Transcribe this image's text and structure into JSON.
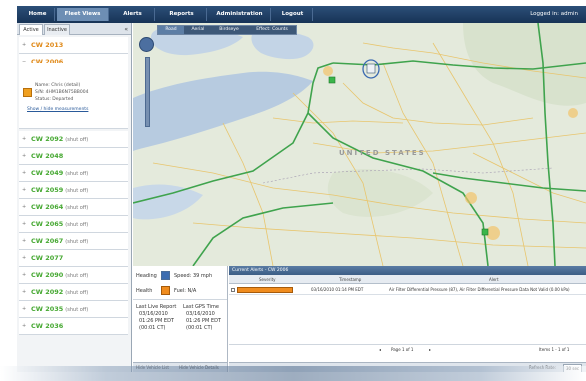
{
  "nav": {
    "tabs": [
      "Home",
      "Fleet Views",
      "Alerts",
      "Reports",
      "Administration",
      "Logout"
    ],
    "logged_in": "Logged in: admin"
  },
  "left": {
    "subtabs": [
      "Active",
      "Inactive"
    ],
    "vehicles": [
      {
        "name": "CW 2013",
        "status": ""
      },
      {
        "name": "CW 2006",
        "status": ""
      },
      {
        "name": "CW 2092",
        "status": "(shut off)"
      },
      {
        "name": "CW 2048",
        "status": ""
      },
      {
        "name": "CW 2049",
        "status": "(shut off)"
      },
      {
        "name": "CW 2059",
        "status": "(shut off)"
      },
      {
        "name": "CW 2064",
        "status": "(shut off)"
      },
      {
        "name": "CW 2065",
        "status": "(shut off)"
      },
      {
        "name": "CW 2067",
        "status": "(shut off)"
      },
      {
        "name": "CW 2077",
        "status": ""
      },
      {
        "name": "CW 2090",
        "status": "(shut off)"
      },
      {
        "name": "CW 2092",
        "status": "(shut off)"
      },
      {
        "name": "CW 2035",
        "status": "(shut off)"
      },
      {
        "name": "CW 2036",
        "status": ""
      }
    ],
    "detail": {
      "line1": "Name: Chris (detail)",
      "line2": "S/N: 4HM1B6N75BB004",
      "line3": "Status: Departed",
      "link": "Show / hide measurements"
    }
  },
  "map": {
    "toolbar": [
      "Road",
      "Aerial",
      "Birdseye",
      "Effect: Counts"
    ],
    "country_label": "UNITED STATES",
    "colors": {
      "water": "#b7cbe0",
      "land": "#e4eadc",
      "highway": "#3fa34d",
      "road": "#f1c766"
    }
  },
  "info": {
    "heading_label": "Heading",
    "speed": "Speed: 39 mph",
    "health_label": "Health",
    "fuel": "Fuel: N/A",
    "last_live_report_title": "Last Live Report",
    "last_live_report": [
      "03/16/2010",
      "01:26 PM EDT",
      "(00:01 CT)"
    ],
    "last_gps_title": "Last GPS Time",
    "last_gps": [
      "03/16/2010",
      "01:26 PM EDT",
      "(00:01 CT)"
    ],
    "toggles": [
      "Hide Vehicle List",
      "Hide Vehicle Details"
    ]
  },
  "alerts": {
    "title": "Current Alerts - CW 2006",
    "columns": [
      "Severity",
      "Timestamp",
      "Alert"
    ],
    "row": {
      "timestamp": "03/16/2010 01:14 PM EDT",
      "alert": "Air Filter Differential Pressure (87), Air Filter Differential Pressure Data Not Valid (0.00 kPa)"
    },
    "pager": "Page 1 of 1",
    "count": "Items 1 - 1 of 1",
    "refresh_label": "Refresh Rate:",
    "refresh_value": "30 sec"
  }
}
